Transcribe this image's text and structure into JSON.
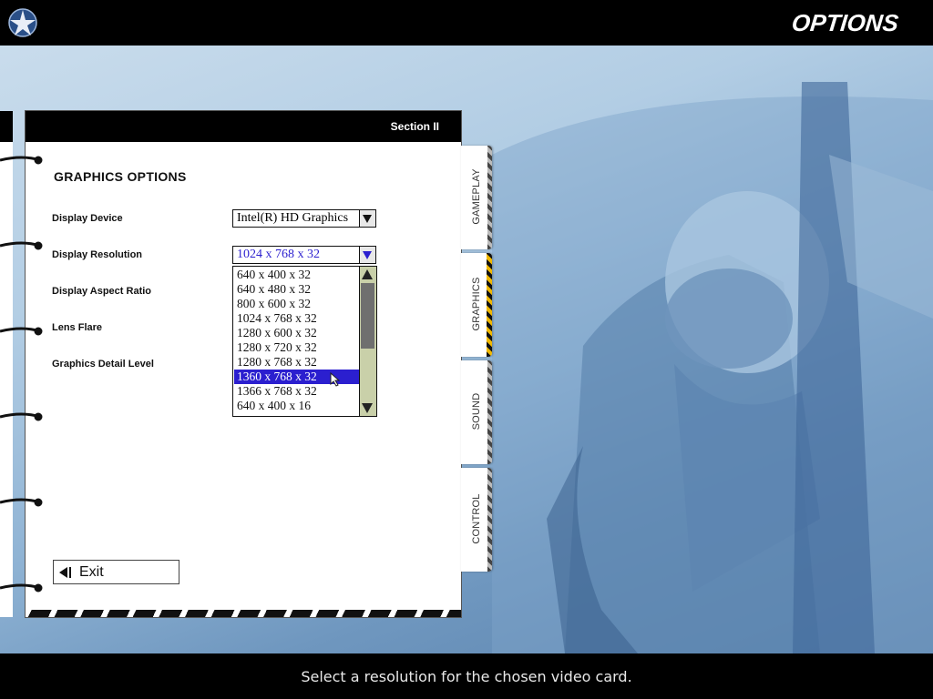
{
  "header": {
    "title": "OPTIONS",
    "logo_icon": "star-emblem-icon"
  },
  "page": {
    "section": "Section II",
    "heading": "GRAPHICS OPTIONS",
    "options": [
      {
        "label": "Display Device"
      },
      {
        "label": "Display Resolution"
      },
      {
        "label": "Display Aspect Ratio"
      },
      {
        "label": "Lens Flare"
      },
      {
        "label": "Graphics Detail Level"
      }
    ],
    "display_device": {
      "value": "Intel(R) HD Graphics"
    },
    "display_resolution": {
      "value": "1024 x 768 x 32",
      "options": [
        "640 x 400 x 32",
        "640 x 480 x 32",
        "800 x 600 x 32",
        "1024 x 768 x 32",
        "1280 x 600 x 32",
        "1280 x 720 x 32",
        "1280 x 768 x 32",
        "1360 x 768 x 32",
        "1366 x 768 x 32",
        "640 x 400 x 16"
      ],
      "highlighted": "1360 x 768 x 32"
    },
    "exit_label": "Exit"
  },
  "tabs": [
    {
      "label": "GAMEPLAY",
      "active": false
    },
    {
      "label": "GRAPHICS",
      "active": true
    },
    {
      "label": "SOUND",
      "active": false
    },
    {
      "label": "CONTROL",
      "active": false
    }
  ],
  "status": {
    "text": "Select a resolution for the chosen video card."
  },
  "colors": {
    "selection": "#2b1fcf",
    "background_blue": "#8fb3d4",
    "tab_stripe_active": "#f0b800"
  }
}
